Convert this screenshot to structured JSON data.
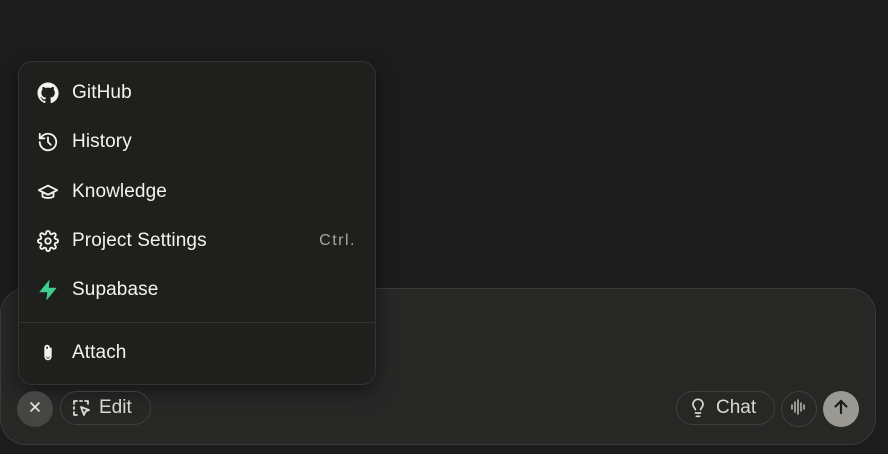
{
  "menu": {
    "items": [
      {
        "label": "GitHub",
        "icon": "github-icon"
      },
      {
        "label": "History",
        "icon": "history-icon"
      },
      {
        "label": "Knowledge",
        "icon": "graduation-cap-icon"
      },
      {
        "label": "Project Settings",
        "icon": "gear-icon",
        "shortcut": "Ctrl."
      },
      {
        "label": "Supabase",
        "icon": "supabase-bolt-icon"
      },
      {
        "label": "Attach",
        "icon": "paperclip-icon"
      }
    ]
  },
  "toolbar": {
    "close_icon": "close-icon",
    "edit_label": "Edit",
    "edit_icon": "select-cursor-icon",
    "chat_label": "Chat",
    "chat_icon": "lightbulb-icon",
    "voice_icon": "waveform-icon",
    "send_icon": "arrow-up-icon"
  },
  "colors": {
    "background": "#1c1c1c",
    "menu_background": "#1f1f1e",
    "composer_background": "#272726",
    "supabase_green": "#3ecf8e",
    "send_button": "#9a9994"
  }
}
